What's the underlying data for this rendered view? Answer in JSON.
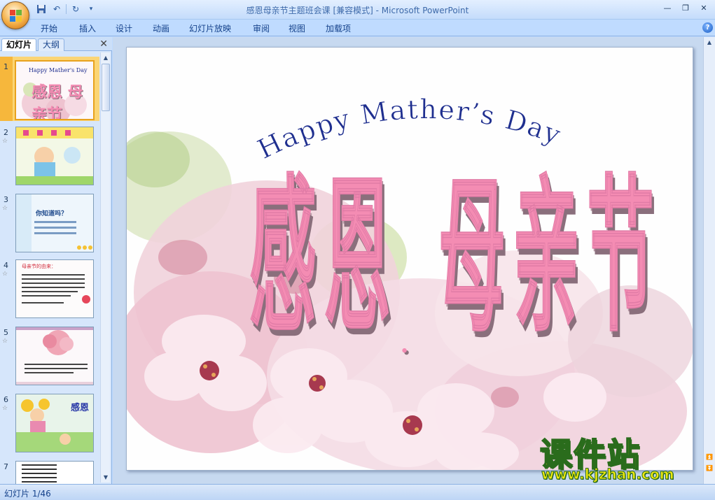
{
  "window": {
    "title": "感恩母亲节主题班会课 [兼容模式] - Microsoft PowerPoint"
  },
  "quick_access": {
    "icons": [
      "save-icon",
      "undo-icon",
      "redo-icon",
      "customize-icon"
    ],
    "undo_glyph": "↶",
    "redo_glyph": "↻",
    "customize_glyph": "▾"
  },
  "window_controls": {
    "minimize": "—",
    "restore": "❐",
    "close": "✕"
  },
  "ribbon": {
    "tabs": [
      "开始",
      "插入",
      "设计",
      "动画",
      "幻灯片放映",
      "审阅",
      "视图",
      "加载项"
    ],
    "help": "?"
  },
  "panel": {
    "tab_slides": "幻灯片",
    "tab_outline": "大纲",
    "close": "✕",
    "thumbnails": [
      {
        "num": "1",
        "selected": true,
        "anim": ""
      },
      {
        "num": "2",
        "selected": false,
        "anim": "☆"
      },
      {
        "num": "3",
        "selected": false,
        "anim": "☆"
      },
      {
        "num": "4",
        "selected": false,
        "anim": "☆"
      },
      {
        "num": "5",
        "selected": false,
        "anim": "☆"
      },
      {
        "num": "6",
        "selected": false,
        "anim": "☆"
      },
      {
        "num": "7",
        "selected": false,
        "anim": ""
      }
    ],
    "thumb_text": {
      "t1_title": "Happy Mather's Day",
      "t1_main": "感恩 母亲节",
      "t3_title": "你知道吗？",
      "t4_title": "母亲节的由来：",
      "t6_title": "感恩"
    }
  },
  "slide": {
    "subtitle": "Happy Mather’s Day",
    "title_chars": [
      "感",
      "恩"
    ],
    "title_chars2": [
      "母",
      "亲",
      "节"
    ],
    "title_dot": "．"
  },
  "watermark": {
    "title": "课件站",
    "url": "www.kjzhan.com"
  },
  "status": {
    "slide_info": "幻灯片 1/46"
  },
  "colors": {
    "accent_pink": "#f48cb3",
    "subtitle_blue": "#1f2f8f",
    "watermark_yellow": "#f1e90f"
  }
}
